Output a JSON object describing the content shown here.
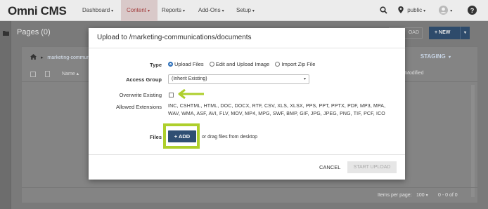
{
  "app": {
    "logo": "Omni CMS"
  },
  "nav": {
    "items": [
      {
        "label": "Dashboard",
        "active": false
      },
      {
        "label": "Content",
        "active": true
      },
      {
        "label": "Reports",
        "active": false
      },
      {
        "label": "Add-Ons",
        "active": false
      },
      {
        "label": "Setup",
        "active": false
      }
    ],
    "site_selector": "public",
    "caret": "▾",
    "icons": {
      "search": "search-icon",
      "location": "map-pin-icon",
      "user": "avatar-icon",
      "help": "help-icon"
    }
  },
  "page": {
    "title": "Pages (0)",
    "upload_button": "OAD",
    "new_button": "+ NEW",
    "breadcrumb": "marketing-commun",
    "staging": "STAGING",
    "column_name": "Name",
    "column_modified": "Modified",
    "items_per_page_label": "Items per page:",
    "items_per_page_value": "100",
    "range": "0 - 0 of 0"
  },
  "modal": {
    "title": "Upload to /marketing-communications/documents",
    "type_label": "Type",
    "type_options": [
      "Upload Files",
      "Edit and Upload Image",
      "Import Zip File"
    ],
    "type_selected": 0,
    "access_group_label": "Access Group",
    "access_group_value": "(Inherit Existing)",
    "overwrite_label": "Overwrite Existing",
    "overwrite_checked": false,
    "allowed_label": "Allowed Extensions",
    "allowed_extensions": "INC, CSHTML, HTML, DOC, DOCX, RTF, CSV, XLS, XLSX, PPS, PPT, PPTX, PDF, MP3, MPA, WAV, WMA, ASF, AVI, FLV, MOV, MP4, MPG, SWF, BMP, GIF, JPG, JPEG, PNG, TIF, PCF, ICO",
    "files_label": "Files",
    "add_button": "+ ADD",
    "drag_text": "or drag files from desktop",
    "cancel_button": "CANCEL",
    "start_button": "START UPLOAD",
    "highlight_color": "#aecf2c",
    "primary_color": "#2f4f73"
  }
}
